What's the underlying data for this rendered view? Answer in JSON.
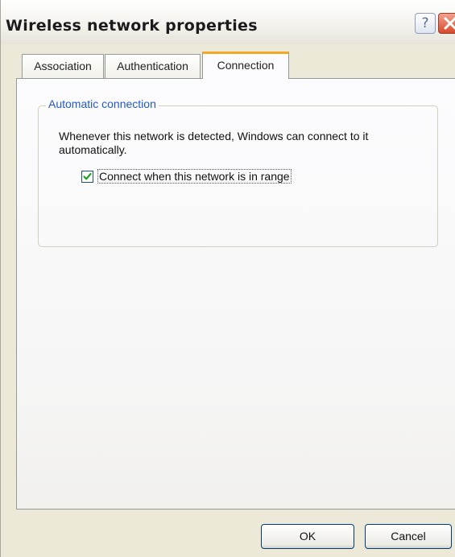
{
  "window": {
    "title": "Wireless network properties",
    "help_label": "?"
  },
  "tabs": [
    {
      "label": "Association",
      "active": false
    },
    {
      "label": "Authentication",
      "active": false
    },
    {
      "label": "Connection",
      "active": true
    }
  ],
  "group": {
    "label": "Automatic connection",
    "description": "Whenever this network is detected, Windows can connect to it automatically.",
    "checkbox": {
      "label": "Connect when this network is in range",
      "checked": true
    }
  },
  "buttons": {
    "ok_label": "OK",
    "cancel_label": "Cancel"
  },
  "colors": {
    "active_tab_accent": "#f5a623",
    "group_label": "#2358c8",
    "check_mark": "#21a121",
    "close_button": "#d7492d"
  },
  "icons": {
    "help": "help-icon",
    "close": "close-icon",
    "check": "check-icon"
  }
}
